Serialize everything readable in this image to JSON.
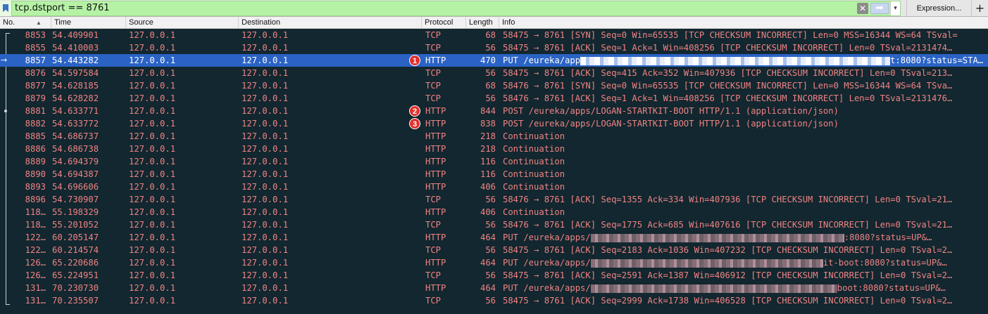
{
  "filter": {
    "value": "tcp.dstport == 8761",
    "clear_glyph": "✕",
    "apply_glyph": "➡",
    "history_glyph": "▾",
    "expression_label": "Expression...",
    "add_label": "+"
  },
  "columns": {
    "no": "No.",
    "time": "Time",
    "source": "Source",
    "destination": "Destination",
    "protocol": "Protocol",
    "length": "Length",
    "info": "Info",
    "sort_indicator": "▲"
  },
  "colors": {
    "row_text": "#f08384",
    "selected_bg": "#2b63c5",
    "background": "#12272f",
    "badge": "#e22f2b"
  },
  "packets": [
    {
      "no": "8853",
      "time": "54.409901",
      "source": "127.0.0.1",
      "destination": "127.0.0.1",
      "protocol": "TCP",
      "length": "68",
      "info": "58475 → 8761 [SYN] Seq=0 Win=65535 [TCP CHECKSUM INCORRECT] Len=0 MSS=16344 WS=64 TSval=",
      "info_tail": ""
    },
    {
      "no": "8855",
      "time": "54.410003",
      "source": "127.0.0.1",
      "destination": "127.0.0.1",
      "protocol": "TCP",
      "length": "56",
      "info": "58475 → 8761 [ACK] Seq=1 Ack=1 Win=408256 [TCP CHECKSUM INCORRECT] Len=0 TSval=2131474…",
      "info_tail": ""
    },
    {
      "no": "8857",
      "time": "54.443282",
      "source": "127.0.0.1",
      "destination": "127.0.0.1",
      "protocol": "HTTP",
      "length": "470",
      "info": "PUT /eureka/app",
      "info_tail": "t:8080?status=STA…",
      "badge": "1",
      "selected": true
    },
    {
      "no": "8876",
      "time": "54.597584",
      "source": "127.0.0.1",
      "destination": "127.0.0.1",
      "protocol": "TCP",
      "length": "56",
      "info": "58475 → 8761 [ACK] Seq=415 Ack=352 Win=407936 [TCP CHECKSUM INCORRECT] Len=0 TSval=213…",
      "info_tail": ""
    },
    {
      "no": "8877",
      "time": "54.628185",
      "source": "127.0.0.1",
      "destination": "127.0.0.1",
      "protocol": "TCP",
      "length": "68",
      "info": "58476 → 8761 [SYN] Seq=0 Win=65535 [TCP CHECKSUM INCORRECT] Len=0 MSS=16344 WS=64 TSva…",
      "info_tail": ""
    },
    {
      "no": "8879",
      "time": "54.628282",
      "source": "127.0.0.1",
      "destination": "127.0.0.1",
      "protocol": "TCP",
      "length": "56",
      "info": "58476 → 8761 [ACK] Seq=1 Ack=1 Win=408256 [TCP CHECKSUM INCORRECT] Len=0 TSval=2131476…",
      "info_tail": ""
    },
    {
      "no": "8881",
      "time": "54.633771",
      "source": "127.0.0.1",
      "destination": "127.0.0.1",
      "protocol": "HTTP",
      "length": "844",
      "info": "POST /eureka/apps/LOGAN-STARTKIT-BOOT HTTP/1.1  (application/json)",
      "info_tail": "",
      "badge": "2"
    },
    {
      "no": "8882",
      "time": "54.633772",
      "source": "127.0.0.1",
      "destination": "127.0.0.1",
      "protocol": "HTTP",
      "length": "838",
      "info": "POST /eureka/apps/LOGAN-STARTKIT-BOOT HTTP/1.1  (application/json)",
      "info_tail": "",
      "badge": "3"
    },
    {
      "no": "8885",
      "time": "54.686737",
      "source": "127.0.0.1",
      "destination": "127.0.0.1",
      "protocol": "HTTP",
      "length": "218",
      "info": "Continuation",
      "info_tail": ""
    },
    {
      "no": "8886",
      "time": "54.686738",
      "source": "127.0.0.1",
      "destination": "127.0.0.1",
      "protocol": "HTTP",
      "length": "218",
      "info": "Continuation",
      "info_tail": ""
    },
    {
      "no": "8889",
      "time": "54.694379",
      "source": "127.0.0.1",
      "destination": "127.0.0.1",
      "protocol": "HTTP",
      "length": "116",
      "info": "Continuation",
      "info_tail": ""
    },
    {
      "no": "8890",
      "time": "54.694387",
      "source": "127.0.0.1",
      "destination": "127.0.0.1",
      "protocol": "HTTP",
      "length": "116",
      "info": "Continuation",
      "info_tail": ""
    },
    {
      "no": "8893",
      "time": "54.696606",
      "source": "127.0.0.1",
      "destination": "127.0.0.1",
      "protocol": "HTTP",
      "length": "406",
      "info": "Continuation",
      "info_tail": ""
    },
    {
      "no": "8896",
      "time": "54.730907",
      "source": "127.0.0.1",
      "destination": "127.0.0.1",
      "protocol": "TCP",
      "length": "56",
      "info": "58476 → 8761 [ACK] Seq=1355 Ack=334 Win=407936 [TCP CHECKSUM INCORRECT] Len=0 TSval=21…",
      "info_tail": ""
    },
    {
      "no": "118…",
      "time": "55.198329",
      "source": "127.0.0.1",
      "destination": "127.0.0.1",
      "protocol": "HTTP",
      "length": "406",
      "info": "Continuation",
      "info_tail": ""
    },
    {
      "no": "118…",
      "time": "55.201052",
      "source": "127.0.0.1",
      "destination": "127.0.0.1",
      "protocol": "TCP",
      "length": "56",
      "info": "58476 → 8761 [ACK] Seq=1775 Ack=685 Win=407616 [TCP CHECKSUM INCORRECT] Len=0 TSval=21…",
      "info_tail": ""
    },
    {
      "no": "122…",
      "time": "60.205147",
      "source": "127.0.0.1",
      "destination": "127.0.0.1",
      "protocol": "HTTP",
      "length": "464",
      "info": "PUT /eureka/apps/",
      "info_tail": ":8080?status=UP&…"
    },
    {
      "no": "122…",
      "time": "60.214574",
      "source": "127.0.0.1",
      "destination": "127.0.0.1",
      "protocol": "TCP",
      "length": "56",
      "info": "58475 → 8761 [ACK] Seq=2183 Ack=1036 Win=407232 [TCP CHECKSUM INCORRECT] Len=0 TSval=2…",
      "info_tail": ""
    },
    {
      "no": "126…",
      "time": "65.220686",
      "source": "127.0.0.1",
      "destination": "127.0.0.1",
      "protocol": "HTTP",
      "length": "464",
      "info": "PUT /eureka/apps/",
      "info_tail": "it-boot:8080?status=UP&…"
    },
    {
      "no": "126…",
      "time": "65.224951",
      "source": "127.0.0.1",
      "destination": "127.0.0.1",
      "protocol": "TCP",
      "length": "56",
      "info": "58475 → 8761 [ACK] Seq=2591 Ack=1387 Win=406912 [TCP CHECKSUM INCORRECT] Len=0 TSval=2…",
      "info_tail": ""
    },
    {
      "no": "131…",
      "time": "70.230730",
      "source": "127.0.0.1",
      "destination": "127.0.0.1",
      "protocol": "HTTP",
      "length": "464",
      "info": "PUT /eureka/apps/",
      "info_tail": "boot:8080?status=UP&…"
    },
    {
      "no": "131…",
      "time": "70.235507",
      "source": "127.0.0.1",
      "destination": "127.0.0.1",
      "protocol": "TCP",
      "length": "56",
      "info": "58475 → 8761 [ACK] Seq=2999 Ack=1738 Win=406528 [TCP CHECKSUM INCORRECT] Len=0 TSval=2…",
      "info_tail": ""
    }
  ]
}
